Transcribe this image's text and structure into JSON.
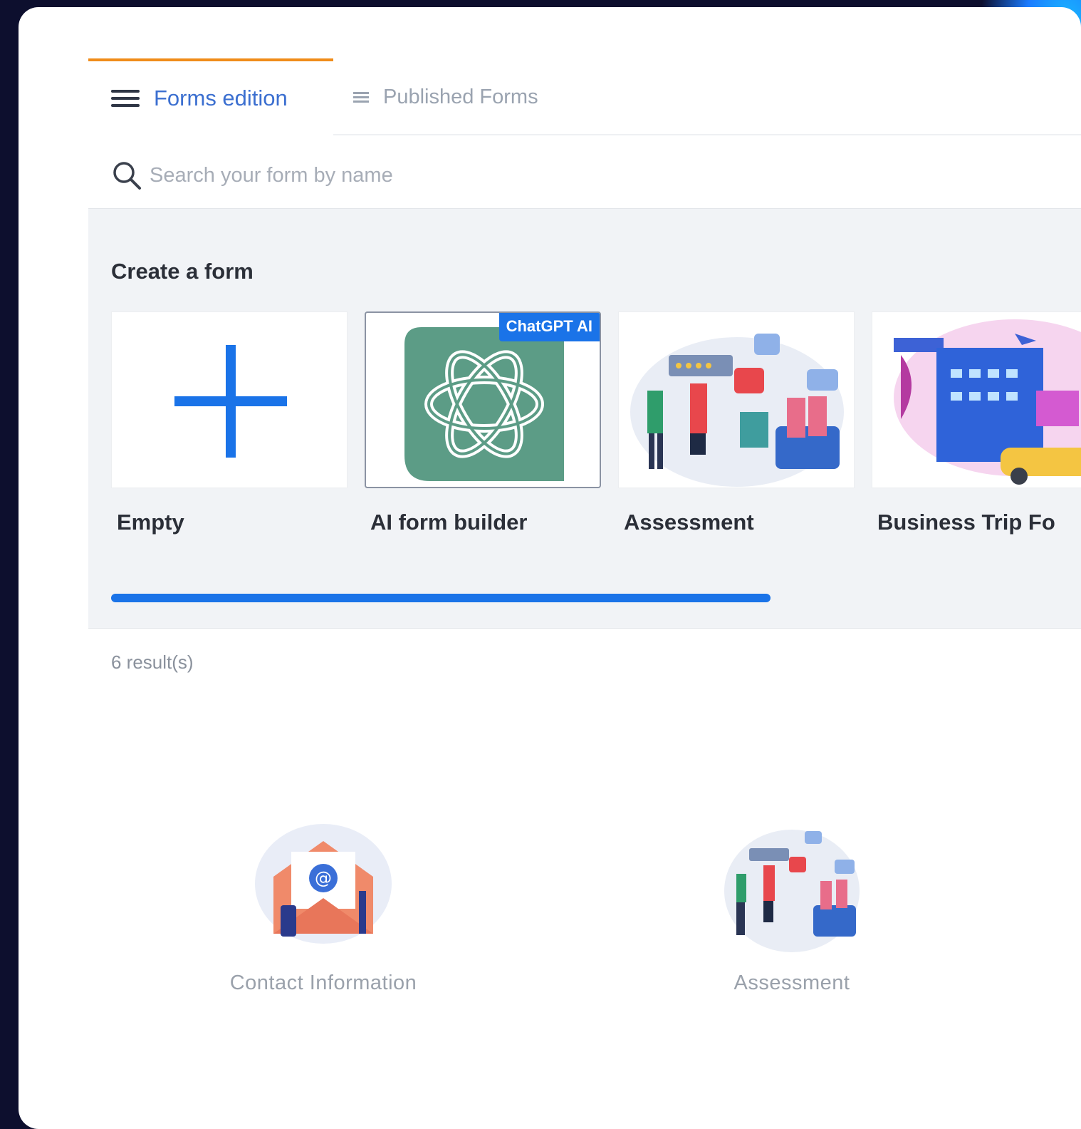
{
  "tabs": [
    {
      "label": "Forms edition",
      "active": true
    },
    {
      "label": "Published Forms",
      "active": false
    }
  ],
  "search": {
    "placeholder": "Search your form by name",
    "value": ""
  },
  "create_section": {
    "title": "Create a form",
    "cards": [
      {
        "label": "Empty",
        "icon": "plus-icon"
      },
      {
        "label": "AI form builder",
        "icon": "chatgpt-logo-icon",
        "badge": "ChatGPT AI",
        "selected": true
      },
      {
        "label": "Assessment",
        "icon": "assessment-illustration"
      },
      {
        "label": "Business Trip Fo",
        "icon": "business-trip-illustration"
      }
    ]
  },
  "results": {
    "count_text": "6 result(s)"
  },
  "forms": [
    {
      "label": "Contact Information",
      "icon": "contact-envelope-illustration"
    },
    {
      "label": "Assessment",
      "icon": "assessment-illustration"
    }
  ],
  "colors": {
    "accent": "#1a73e8",
    "active_tab_top": "#f08c1a",
    "chatgpt_green": "#5c9c86",
    "background": "#0d0f2e"
  }
}
